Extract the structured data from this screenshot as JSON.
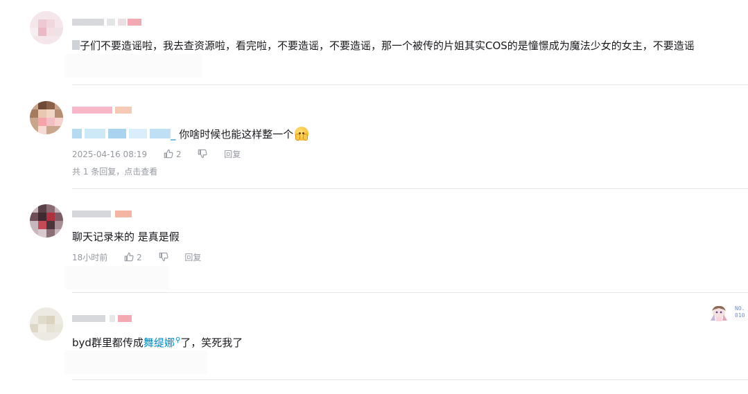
{
  "comments": [
    {
      "text_tail": "子们不要造谣啦，我去查资源啦，看完啦，不要造谣，不要造谣，那一个被传的片姐其实COS的是憧憬成为魔法少女的女主，不要造谣"
    },
    {
      "mention_tail": "_",
      "text": "你啥时候也能这样整一个",
      "emoji": "hand-over-mouth-emoji",
      "time": "2025-04-16 08:19",
      "likes": "2",
      "reply_label": "回复",
      "sub_reply_text": "共 1 条回复，点击查看"
    },
    {
      "text": "聊天记录来的 是真是假",
      "time": "18小时前",
      "likes": "2",
      "reply_label": "回复"
    },
    {
      "text_prefix": "byd群里都传成",
      "link_text": "舞缇娜",
      "text_suffix": "了，笑死我了",
      "fan_badge_no": "NO.\n010"
    }
  ],
  "colors": {
    "link": "#008ac5",
    "meta": "#9499a0",
    "divider": "#e3e5e7"
  },
  "icons": [
    "thumb-up-icon",
    "thumb-down-icon",
    "search-icon"
  ]
}
